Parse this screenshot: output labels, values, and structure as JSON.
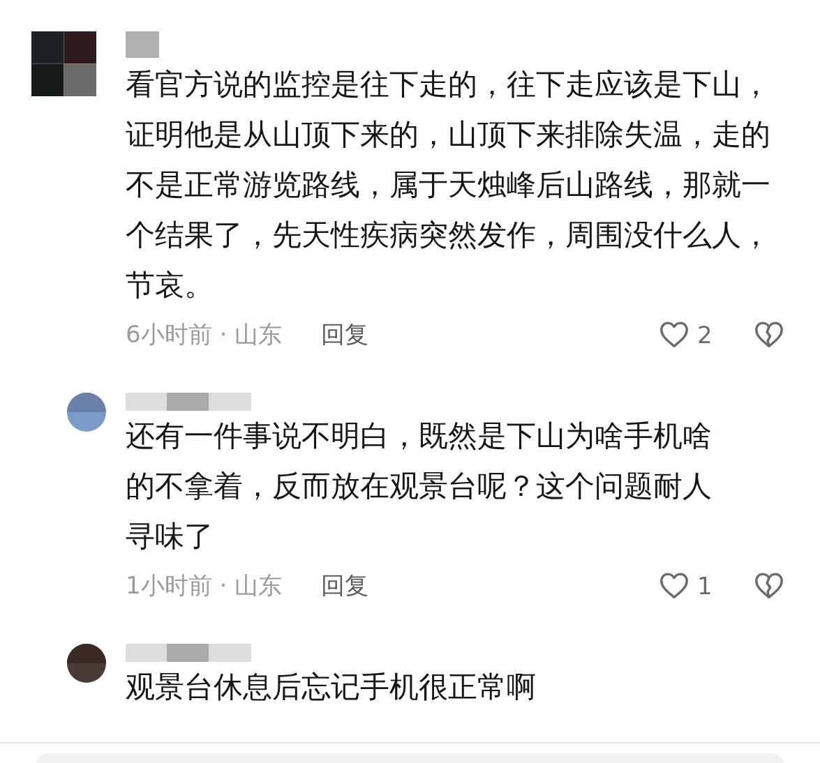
{
  "comments": [
    {
      "kind": "mosaic",
      "text": "看官方说的监控是往下走的，往下走应该是下山，证明他是从山顶下来的，山顶下来排除失温，走的不是正常游览路线，属于天烛峰后山路线，那就一个结果了，先天性疾病突然发作，周围没什么人，节哀。",
      "meta": "6小时前 · 山东",
      "reply_label": "回复",
      "likes": "2",
      "liked": false,
      "replies": [
        {
          "kind": "photo",
          "text": "还有一件事说不明白，既然是下山为啥手机啥的不拿着，反而放在观景台呢？这个问题耐人寻味了",
          "meta": "1小时前 · 山东",
          "reply_label": "回复",
          "likes": "1",
          "liked": false
        },
        {
          "kind": "photo",
          "text": "观景台休息后忘记手机很正常啊"
        }
      ]
    }
  ]
}
